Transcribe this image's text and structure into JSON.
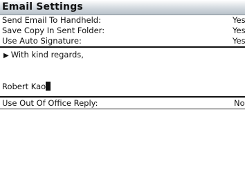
{
  "title": "Email Settings",
  "settings": [
    {
      "label": "Send Email To Handheld:",
      "value": "Yes"
    },
    {
      "label": "Save Copy In Sent Folder:",
      "value": "Yes"
    },
    {
      "label": "Use Auto Signature:",
      "value": "Yes"
    }
  ],
  "signature": {
    "line1": "With kind regards,",
    "line2": "",
    "line3": "Robert Kao"
  },
  "out_of_office": {
    "label": "Use Out Of Office Reply:",
    "value": "No"
  },
  "icons": {
    "bullet": "triangle-right-icon",
    "cursor": "text-cursor"
  }
}
